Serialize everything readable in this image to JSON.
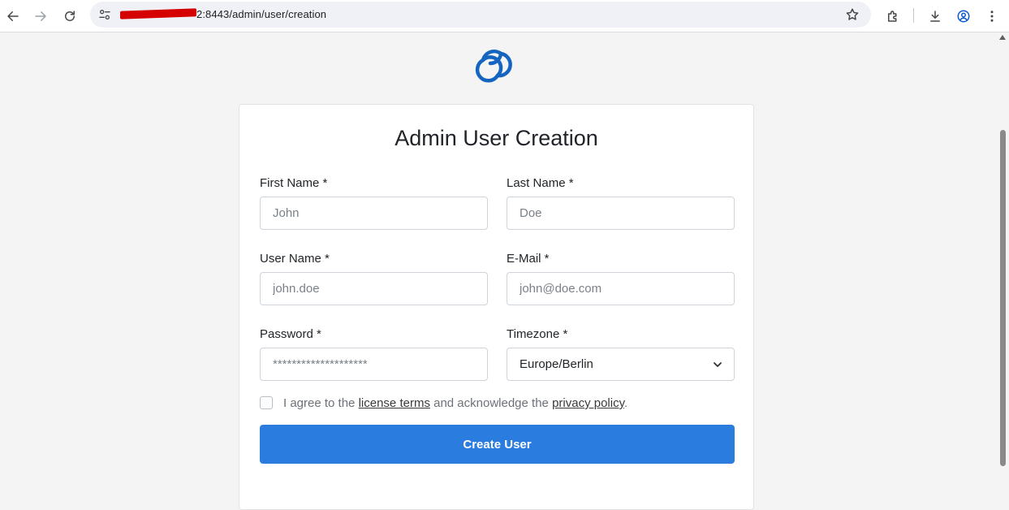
{
  "browser": {
    "url_visible": "2:8443/admin/user/creation",
    "icons": [
      "back-icon",
      "forward-icon",
      "reload-icon",
      "site-settings-icon",
      "bookmark-star-icon",
      "extensions-icon",
      "download-icon",
      "profile-icon",
      "menu-icon"
    ]
  },
  "page": {
    "logo": "cloud-logo-icon",
    "accent_color": "#2a7ddf",
    "title": "Admin User Creation"
  },
  "form": {
    "first_name": {
      "label": "First Name *",
      "placeholder": "John"
    },
    "last_name": {
      "label": "Last Name *",
      "placeholder": "Doe"
    },
    "user_name": {
      "label": "User Name *",
      "placeholder": "john.doe"
    },
    "email": {
      "label": "E-Mail *",
      "placeholder": "john@doe.com"
    },
    "password": {
      "label": "Password *",
      "placeholder": "********************"
    },
    "timezone": {
      "label": "Timezone *",
      "value": "Europe/Berlin"
    },
    "agree": {
      "prefix": "I agree to the",
      "license_link": "license terms",
      "middle": "and acknowledge the",
      "privacy_link": "privacy policy",
      "suffix": "."
    },
    "submit_label": "Create User"
  }
}
